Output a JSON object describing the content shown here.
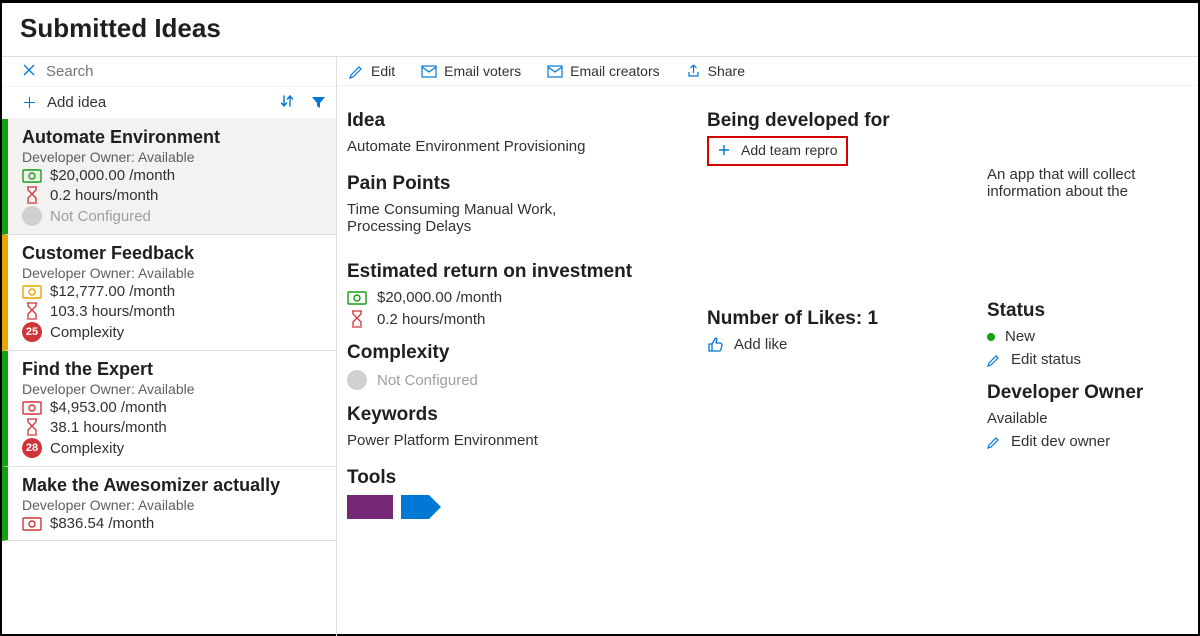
{
  "page": {
    "title": "Submitted Ideas"
  },
  "search": {
    "placeholder": "Search"
  },
  "addIdea": {
    "label": "Add idea"
  },
  "colors": {
    "green": "#13a10e",
    "amber": "#eaa300",
    "red": "#d13438",
    "grayBadge": "#d2d0ce",
    "moneyGreen": "#13a10e",
    "moneyAmber": "#eaa300",
    "hourRed": "#d13438",
    "blue": "#0078d4"
  },
  "cards": [
    {
      "title": "Automate Environment",
      "owner": "Developer Owner: Available",
      "money": "$20,000.00 /month",
      "moneyColor": "#13a10e",
      "hours": "0.2 hours/month",
      "complexityLabel": "Not Configured",
      "complexityBadge": "",
      "complexityBadgeBg": "#d2d0ce",
      "border": "#13a10e",
      "selected": true,
      "grayLine": true
    },
    {
      "title": "Customer Feedback",
      "owner": "Developer Owner: Available",
      "money": "$12,777.00 /month",
      "moneyColor": "#eaa300",
      "hours": "103.3 hours/month",
      "complexityLabel": "Complexity",
      "complexityBadge": "25",
      "complexityBadgeBg": "#d13438",
      "border": "#eaa300",
      "selected": false,
      "grayLine": false
    },
    {
      "title": "Find the Expert",
      "owner": "Developer Owner: Available",
      "money": "$4,953.00 /month",
      "moneyColor": "#d13438",
      "hours": "38.1 hours/month",
      "complexityLabel": "Complexity",
      "complexityBadge": "28",
      "complexityBadgeBg": "#d13438",
      "border": "#13a10e",
      "selected": false,
      "grayLine": false
    },
    {
      "title": "Make the Awesomizer actually",
      "owner": "Developer Owner: Available",
      "money": "$836.54 /month",
      "moneyColor": "#d13438",
      "hours": "",
      "complexityLabel": "",
      "complexityBadge": "",
      "complexityBadgeBg": "",
      "border": "#13a10e",
      "selected": false,
      "grayLine": false
    }
  ],
  "toolbar": {
    "edit": "Edit",
    "emailVoters": "Email voters",
    "emailCreators": "Email creators",
    "share": "Share"
  },
  "detail": {
    "ideaHeading": "Idea",
    "ideaText": "Automate Environment Provisioning",
    "painHeading": "Pain Points",
    "painText": "Time Consuming Manual Work, Processing Delays",
    "roiHeading": "Estimated return on investment",
    "roiMoney": "$20,000.00 /month",
    "roiHours": "0.2 hours/month",
    "complexityHeading": "Complexity",
    "complexityText": "Not Configured",
    "keywordsHeading": "Keywords",
    "keywordsText": "Power Platform Environment",
    "toolsHeading": "Tools",
    "developedHeading": "Being developed for",
    "addTeamRepro": "Add team repro",
    "descText": "An app that will collect information about the",
    "likesHeading": "Number of Likes: 1",
    "addLike": "Add like",
    "statusHeading": "Status",
    "statusValue": "New",
    "editStatus": "Edit status",
    "devOwnerHeading": "Developer Owner",
    "devOwnerValue": "Available",
    "editDevOwner": "Edit dev owner"
  }
}
